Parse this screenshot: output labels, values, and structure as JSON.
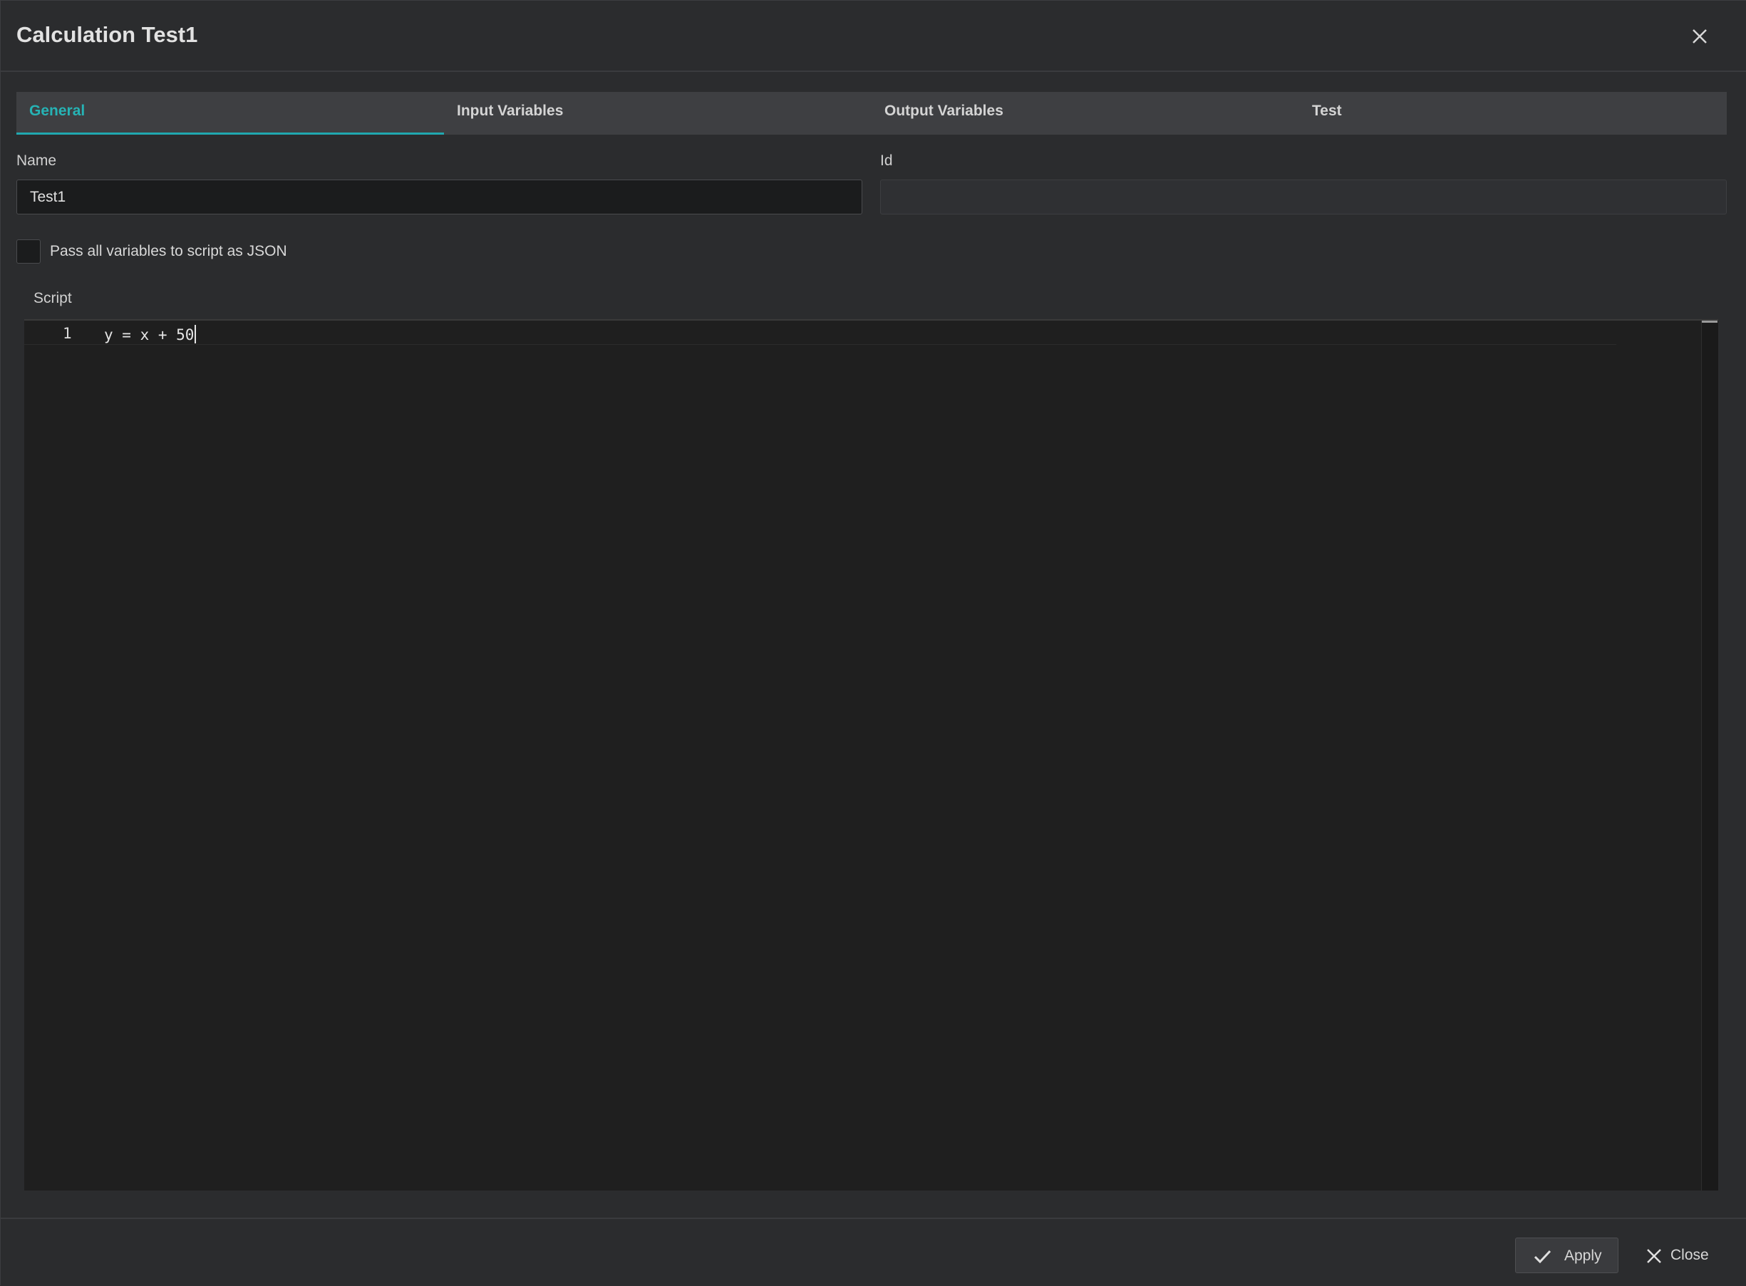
{
  "dialog": {
    "title": "Calculation Test1",
    "close_icon": "close-icon"
  },
  "tabs": [
    {
      "label": "General",
      "active": true
    },
    {
      "label": "Input Variables",
      "active": false
    },
    {
      "label": "Output Variables",
      "active": false
    },
    {
      "label": "Test",
      "active": false
    }
  ],
  "form": {
    "name_label": "Name",
    "name_value": "Test1",
    "id_label": "Id",
    "id_value": "",
    "json_checkbox_label": "Pass all variables to script as JSON",
    "json_checkbox_checked": false,
    "script_label": "Script"
  },
  "editor": {
    "lines": [
      {
        "number": "1",
        "code": "y = x + 50"
      }
    ]
  },
  "footer": {
    "apply_label": "Apply",
    "apply_icon": "check-icon",
    "close_label": "Close",
    "close_icon": "close-icon"
  },
  "colors": {
    "accent": "#20a8b0",
    "background": "#2b2c2e",
    "editor_background": "#1f1f1f"
  }
}
